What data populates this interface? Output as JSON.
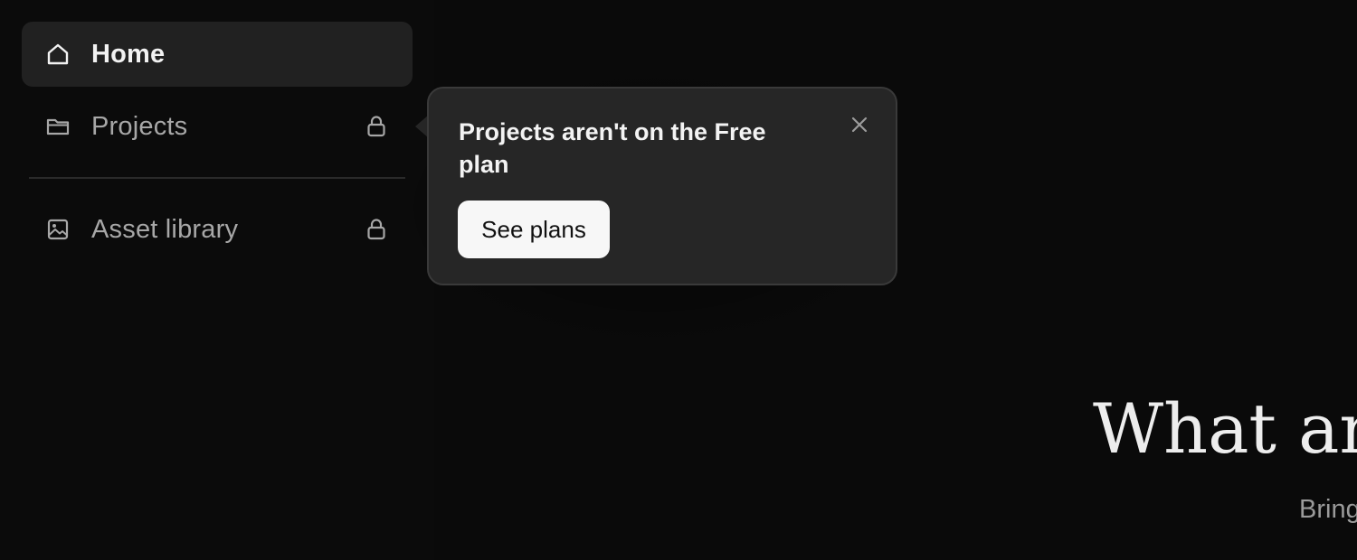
{
  "sidebar": {
    "items": [
      {
        "label": "Home",
        "icon": "home-icon",
        "active": true,
        "locked": false
      },
      {
        "label": "Projects",
        "icon": "folder-icon",
        "active": false,
        "locked": true
      },
      {
        "label": "Asset library",
        "icon": "image-icon",
        "active": false,
        "locked": true
      }
    ]
  },
  "popover": {
    "title": "Projects aren't on the Free plan",
    "button_label": "See plans",
    "close_icon": "close-icon"
  },
  "main": {
    "heading": "What are",
    "subheading": "Bring"
  },
  "colors": {
    "background": "#0b0b0b",
    "active_item": "#212121",
    "popover_bg": "#262626",
    "button_bg": "#f7f7f7"
  }
}
